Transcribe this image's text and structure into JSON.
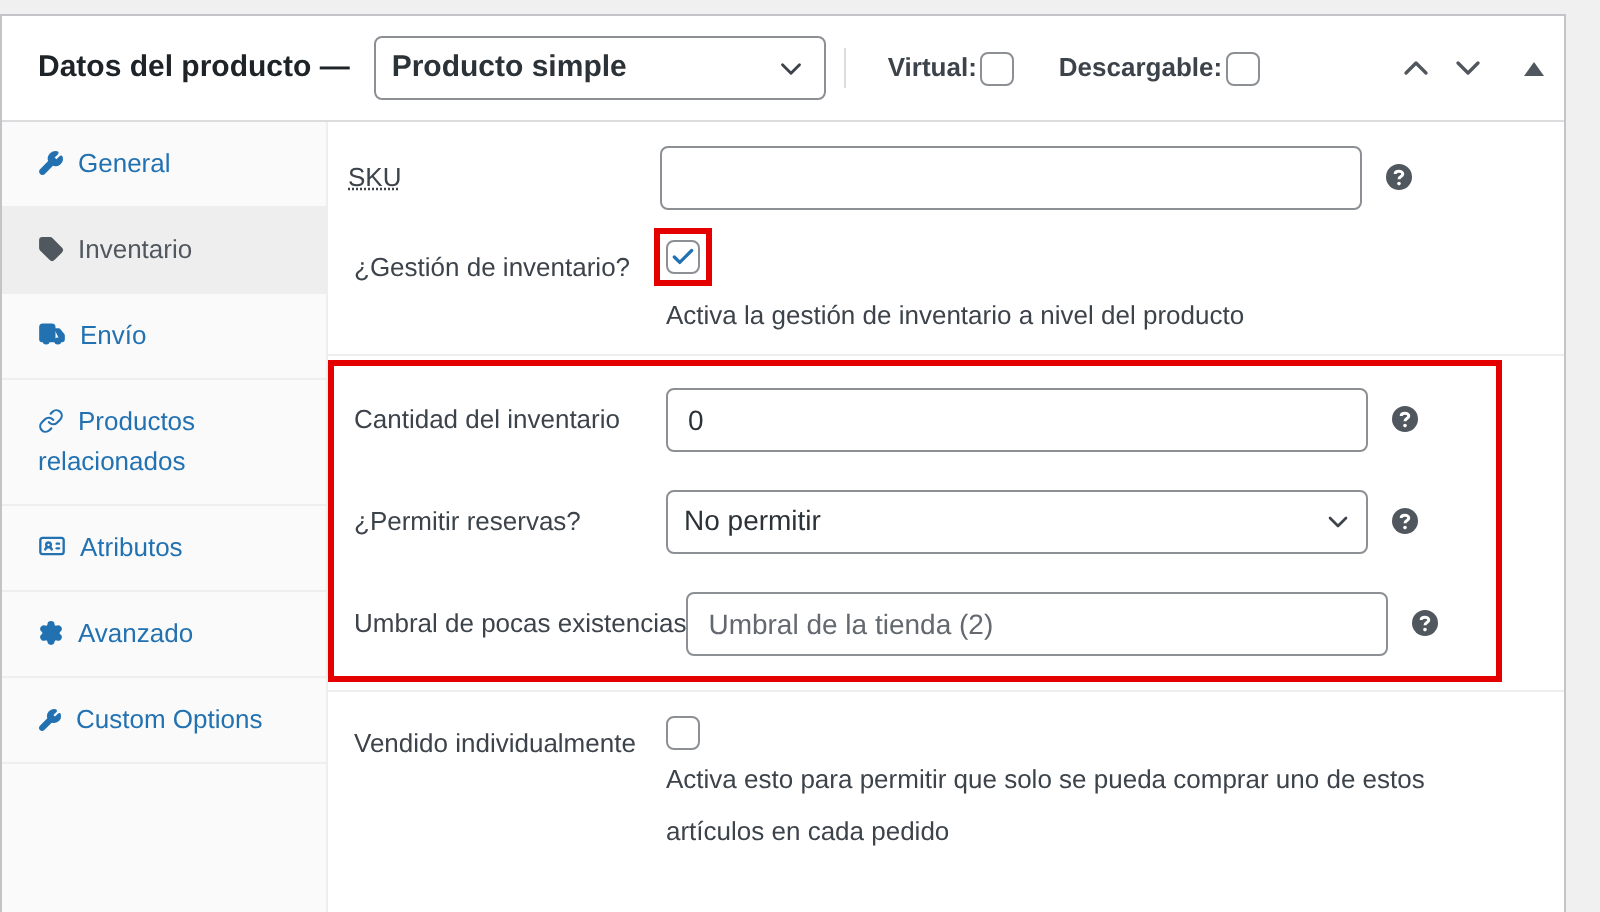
{
  "header": {
    "title": "Datos del producto —",
    "product_type": "Producto simple",
    "options": [
      {
        "label": "Virtual:",
        "checked": false
      },
      {
        "label": "Descargable:",
        "checked": false
      }
    ]
  },
  "tabs": [
    {
      "label": "General",
      "selected": false
    },
    {
      "label": "Inventario",
      "selected": true
    },
    {
      "label": "Envío",
      "selected": false
    },
    {
      "label": "Productos relacionados",
      "selected": false
    },
    {
      "label": "Atributos",
      "selected": false
    },
    {
      "label": "Avanzado",
      "selected": false
    },
    {
      "label": "Custom Options",
      "selected": false
    }
  ],
  "sections": [
    {
      "highlighted": false,
      "fields": [
        {
          "kind": "text",
          "label": "SKU"
        },
        {
          "kind": "checkbox",
          "label": "¿Gestión de inventario?",
          "checked": true,
          "highlighted": true,
          "description": "Activa la gestión de inventario a nivel del producto"
        }
      ]
    },
    {
      "highlighted": true,
      "fields": [
        {
          "kind": "text",
          "label": "Cantidad del inventario",
          "value": "0"
        },
        {
          "kind": "select",
          "label": "¿Permitir reservas?",
          "value": "No permitir"
        },
        {
          "kind": "text",
          "label": "Umbral de pocas existencias",
          "placeholder": "Umbral de la tienda (2)"
        }
      ]
    },
    {
      "highlighted": false,
      "fields": [
        {
          "kind": "checkbox",
          "label": "Vendido individualmente",
          "checked": false,
          "highlighted": false,
          "description": "Activa esto para permitir que solo se pueda comprar uno de estos artículos en cada pedido"
        }
      ]
    }
  ]
}
